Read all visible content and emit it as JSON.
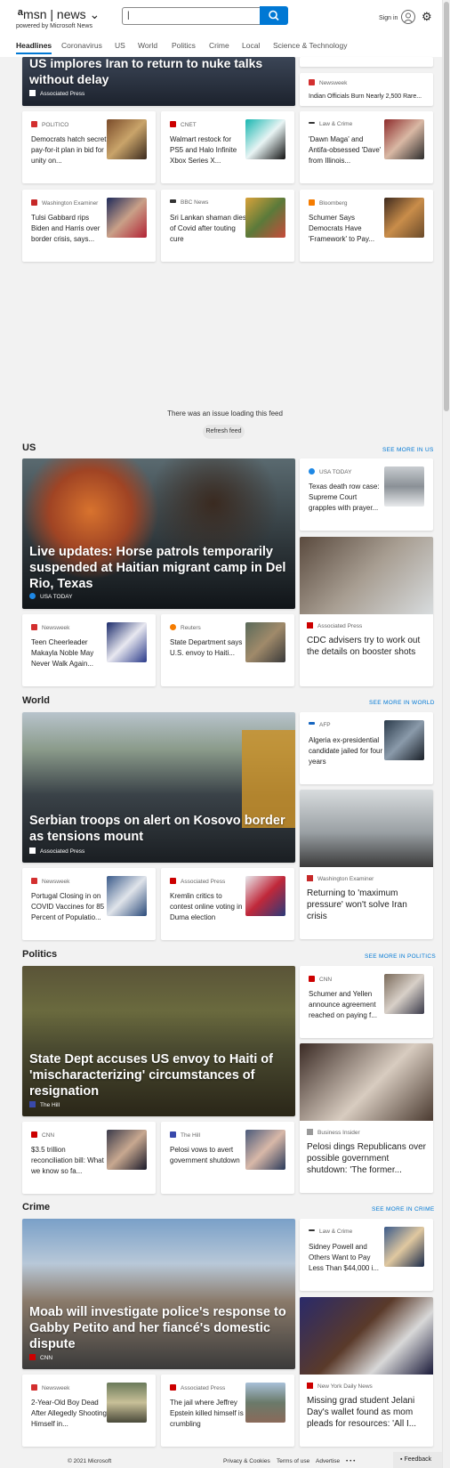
{
  "header": {
    "brand": "msn",
    "news": "news ⌄",
    "powered": "powered by Microsoft News",
    "sign_in": "Sign in",
    "search_value": "|"
  },
  "nav": [
    "Headlines",
    "Coronavirus",
    "US",
    "World",
    "Politics",
    "Crime",
    "Local",
    "Science & Technology"
  ],
  "top": {
    "hero_title": "US implores Iran to return to nuke talks without delay",
    "hero_source": "Associated Press",
    "side_top_source": "Newsweek",
    "side_top_title": "Indian Officials Burn Nearly 2,500 Rare..."
  },
  "row1": [
    {
      "source": "POLITICO",
      "title": "Democrats hatch secret pay-for-it plan in bid for unity on...",
      "color": "#d32f2f"
    },
    {
      "source": "CNET",
      "title": "Walmart restock for PS5 and Halo Infinite Xbox Series X...",
      "color": "#c00"
    },
    {
      "source": "Law & Crime",
      "title": "'Dawn Maga' and Antifa-obsessed 'Dave' from Illinois...",
      "color": "#333"
    }
  ],
  "row2": [
    {
      "source": "Washington Examiner",
      "title": "Tulsi Gabbard rips Biden and Harris over border crisis, says...",
      "color": "#c62828"
    },
    {
      "source": "BBC News",
      "title": "Sri Lankan shaman dies of Covid after touting cure",
      "color": "#333"
    },
    {
      "source": "Bloomberg",
      "title": "Schumer Says Democrats Have 'Framework' to Pay...",
      "color": "#f57c00"
    }
  ],
  "feed_error": "There was an issue loading this feed",
  "refresh": "Refresh feed",
  "us": {
    "label": "US",
    "more": "SEE MORE IN US",
    "hero_title": "Live updates: Horse patrols temporarily suspended at Haitian migrant camp in Del Rio, Texas",
    "hero_source": "USA TODAY",
    "side1": {
      "source": "USA TODAY",
      "title": "Texas death row case: Supreme Court grapples with prayer..."
    },
    "tall": {
      "source": "Associated Press",
      "title": "CDC advisers try to work out the details on booster shots"
    },
    "small": [
      {
        "source": "Newsweek",
        "title": "Teen Cheerleader Makayla Noble May Never Walk Again..."
      },
      {
        "source": "Reuters",
        "title": "State Department says U.S. envoy to Haiti..."
      }
    ]
  },
  "world": {
    "label": "World",
    "more": "SEE MORE IN WORLD",
    "hero_title": "Serbian troops on alert on Kosovo border as tensions mount",
    "hero_source": "Associated Press",
    "side1": {
      "source": "AFP",
      "title": "Algeria ex-presidential candidate jailed for four years"
    },
    "tall": {
      "source": "Washington Examiner",
      "title": "Returning to 'maximum pressure' won't solve Iran crisis"
    },
    "small": [
      {
        "source": "Newsweek",
        "title": "Portugal Closing in on COVID Vaccines for 85 Percent of Populatio..."
      },
      {
        "source": "Associated Press",
        "title": "Kremlin critics to contest online voting in Duma election"
      }
    ]
  },
  "politics": {
    "label": "Politics",
    "more": "SEE MORE IN POLITICS",
    "hero_title": "State Dept accuses US envoy to Haiti of 'mischaracterizing' circumstances of resignation",
    "hero_source": "The Hill",
    "side1": {
      "source": "CNN",
      "title": "Schumer and Yellen announce agreement reached on paying f..."
    },
    "tall": {
      "source": "Business Insider",
      "title": "Pelosi dings Republicans over possible government shutdown: 'The former..."
    },
    "small": [
      {
        "source": "CNN",
        "title": "$3.5 trillion reconciliation bill: What we know so fa..."
      },
      {
        "source": "The Hill",
        "title": "Pelosi vows to avert government shutdown"
      }
    ]
  },
  "crime": {
    "label": "Crime",
    "more": "SEE MORE IN CRIME",
    "hero_title": "Moab will investigate police's response to Gabby Petito and her fiancé's domestic dispute",
    "hero_source": "CNN",
    "side1": {
      "source": "Law & Crime",
      "title": "Sidney Powell and Others Want to Pay Less Than $44,000 i..."
    },
    "tall": {
      "source": "New York Daily News",
      "title": "Missing grad student Jelani Day's wallet found as mom pleads for resources: 'All I..."
    },
    "small": [
      {
        "source": "Newsweek",
        "title": "2-Year-Old Boy Dead After Allegedly Shooting Himself in..."
      },
      {
        "source": "Associated Press",
        "title": "The jail where Jeffrey Epstein killed himself is crumbling"
      }
    ]
  },
  "footer": {
    "copyright": "© 2021 Microsoft",
    "privacy": "Privacy & Cookies",
    "terms": "Terms of use",
    "advertise": "Advertise",
    "more": "• • •",
    "feedback": "Feedback"
  }
}
